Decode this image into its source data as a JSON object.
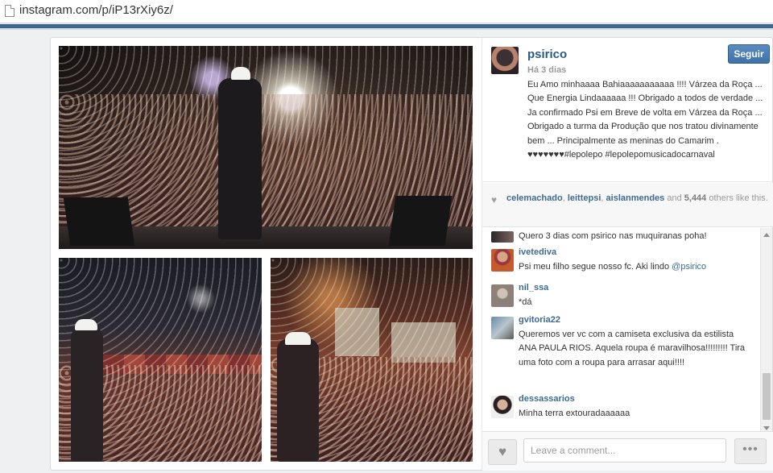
{
  "browser": {
    "url": "instagram.com/p/iP13rXiy6z/"
  },
  "post": {
    "username": "psirico",
    "time_ago": "Há 3 dias",
    "follow_label": "Seguir",
    "caption_text": "Eu Amo minhaaaa Bahiaaaaaaaaaaa !!!! Várzea da Roça ... Que Energia Lindaaaaaa !!! Obrigado a todos de verdade ... Ja confirmado Psi em Breve de volta em Várzea da Roça ... Obrigado a turma da Produção que nos tratou divinamente bem ... Principalmente as meninas do Camarim . ♥♥♥♥♥♥♥",
    "caption_tags": "#lepolepo #lepolepomusicadocarnaval"
  },
  "likes": {
    "users": [
      "celemachado",
      "leittepsi",
      "aislanmendes"
    ],
    "separator": ", ",
    "and_word": " and ",
    "count": "5,444",
    "suffix": " others like this."
  },
  "comments": [
    {
      "user": "",
      "text": "Quero 3 dias com psirico nas muquiranas poha!"
    },
    {
      "user": "ivetediva",
      "text": "Psi meu filho segue nosso fc. Aki lindo ",
      "mention": "@psirico"
    },
    {
      "user": "nil_ssa",
      "text": "*dá"
    },
    {
      "user": "gvitoria22",
      "text": "Queremos ver vc com a camiseta exclusiva da estilista ANA PAULA RIOS. Aquela roupa é maravilhosa!!!!!!!!! Tira uma foto com a roupa para arrasar aqui!!!!"
    },
    {
      "user": "dessassarios",
      "text": "Minha terra extouradaaaaaa"
    }
  ],
  "footer": {
    "comment_placeholder": "Leave a comment...",
    "more_label": "•••"
  },
  "colors": {
    "link_blue": "#3f6a91",
    "follow_button": "#4a7db4",
    "header_strip": "#3d6690"
  },
  "icons": {
    "like": "heart-icon",
    "likes_marker": "heart-small-icon",
    "page": "page-icon",
    "more": "ellipsis-icon"
  }
}
